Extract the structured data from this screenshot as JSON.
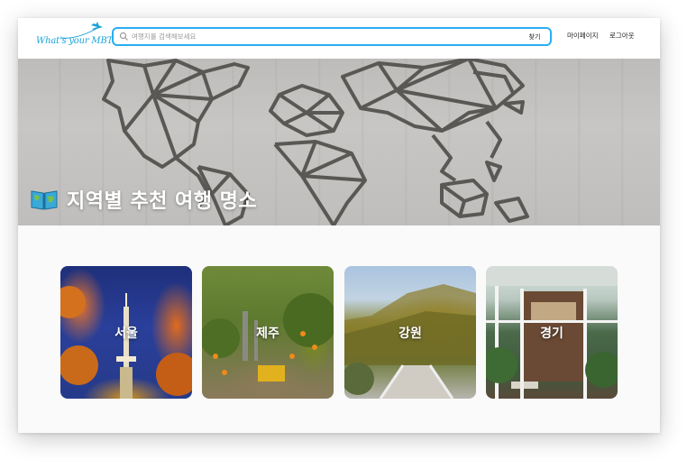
{
  "header": {
    "logo_text": "What's your MBTI",
    "search": {
      "placeholder": "여행지를 검색해보세요",
      "value": "",
      "button_label": "찾기"
    },
    "nav": {
      "mypage": "마이페이지",
      "logout": "로그아웃"
    }
  },
  "hero": {
    "title": "지역별 추천 여행 명소",
    "icon": "map-book-icon"
  },
  "regions": [
    {
      "label": "서울"
    },
    {
      "label": "제주"
    },
    {
      "label": "강원"
    },
    {
      "label": "경기"
    }
  ],
  "colors": {
    "accent": "#29aef2",
    "logo": "#1aa3d9",
    "hero_bg": "#c2c1bf",
    "map_lines": "#5a5854"
  }
}
